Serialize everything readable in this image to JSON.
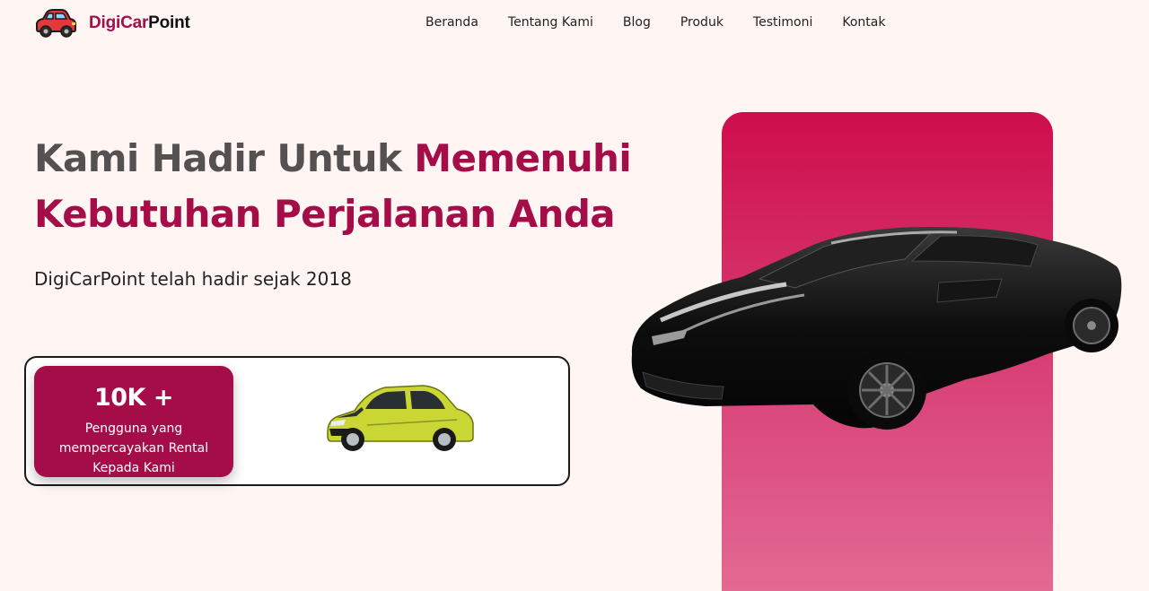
{
  "brand": {
    "name_part1": "DigiCar",
    "name_part2": "Point",
    "logo_icon": "red-car-icon"
  },
  "nav": {
    "items": [
      {
        "label": "Beranda"
      },
      {
        "label": "Tentang Kami"
      },
      {
        "label": "Blog"
      },
      {
        "label": "Produk"
      },
      {
        "label": "Testimoni"
      },
      {
        "label": "Kontak"
      }
    ]
  },
  "hero": {
    "title_dark": "Kami Hadir Untuk ",
    "title_accent_line1": "Memenuhi",
    "title_accent_line2": "Kebutuhan Perjalanan Anda",
    "subtitle": "DigiCarPoint telah hadir sejak 2018"
  },
  "stats": {
    "value": "10K +",
    "label": "Pengguna yang mempercayakan Rental Kepada Kami"
  },
  "colors": {
    "accent": "#a50d48",
    "background": "#fff6f4",
    "panel_top": "#ce0d4c",
    "panel_bottom": "#e46e96",
    "heading_dark": "#565151"
  }
}
